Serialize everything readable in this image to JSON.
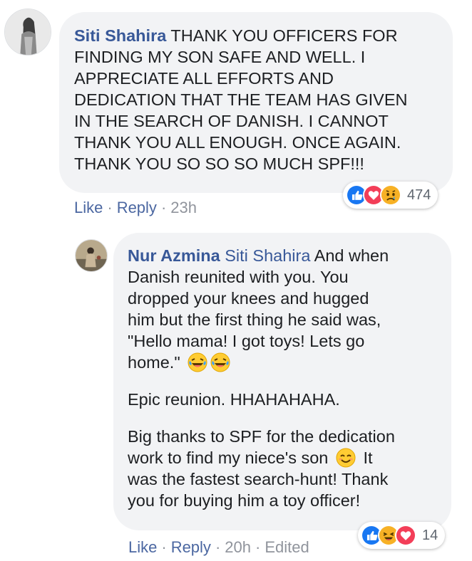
{
  "comment": {
    "author": "Siti Shahira",
    "lines": [
      "THANK YOU OFFICERS FOR",
      "FINDING MY SON SAFE AND WELL. I",
      "APPRECIATE ALL EFFORTS AND",
      "DEDICATION THAT THE TEAM HAS GIVEN",
      "IN THE SEARCH OF DANISH. I CANNOT",
      "THANK YOU ALL ENOUGH. ONCE AGAIN.",
      "THANK YOU SO SO SO MUCH SPF!!!"
    ],
    "reactions": [
      "like",
      "love",
      "sad"
    ],
    "reaction_count": "474",
    "actions": {
      "like": "Like",
      "reply": "Reply",
      "time": "23h"
    }
  },
  "reply": {
    "author": "Nur Azmina",
    "mention": "Siti Shahira",
    "p1_lines": [
      "And when",
      "Danish reunited with you. You",
      "dropped your knees and hugged",
      "him but the first thing he said was,",
      "\"Hello mama! I got toys! Lets go",
      "home.\""
    ],
    "p1_emojis": [
      "laughing-crying",
      "laughing-crying"
    ],
    "p2": "Epic reunion. HHAHAHAHA.",
    "p3_lines": [
      "Big thanks to SPF for the dedication",
      "work to find my niece's son",
      "It",
      "was the fastest search-hunt! Thank",
      "you for buying him a toy officer!"
    ],
    "p3_emoji": "smiling-blush",
    "reactions": [
      "like",
      "haha",
      "love"
    ],
    "reaction_count": "14",
    "actions": {
      "like": "Like",
      "reply": "Reply",
      "time": "20h",
      "edited": "Edited"
    }
  },
  "colors": {
    "name": "#385898",
    "link": "#4b67a1",
    "meta": "#90949c",
    "bubble": "#f2f3f5"
  }
}
